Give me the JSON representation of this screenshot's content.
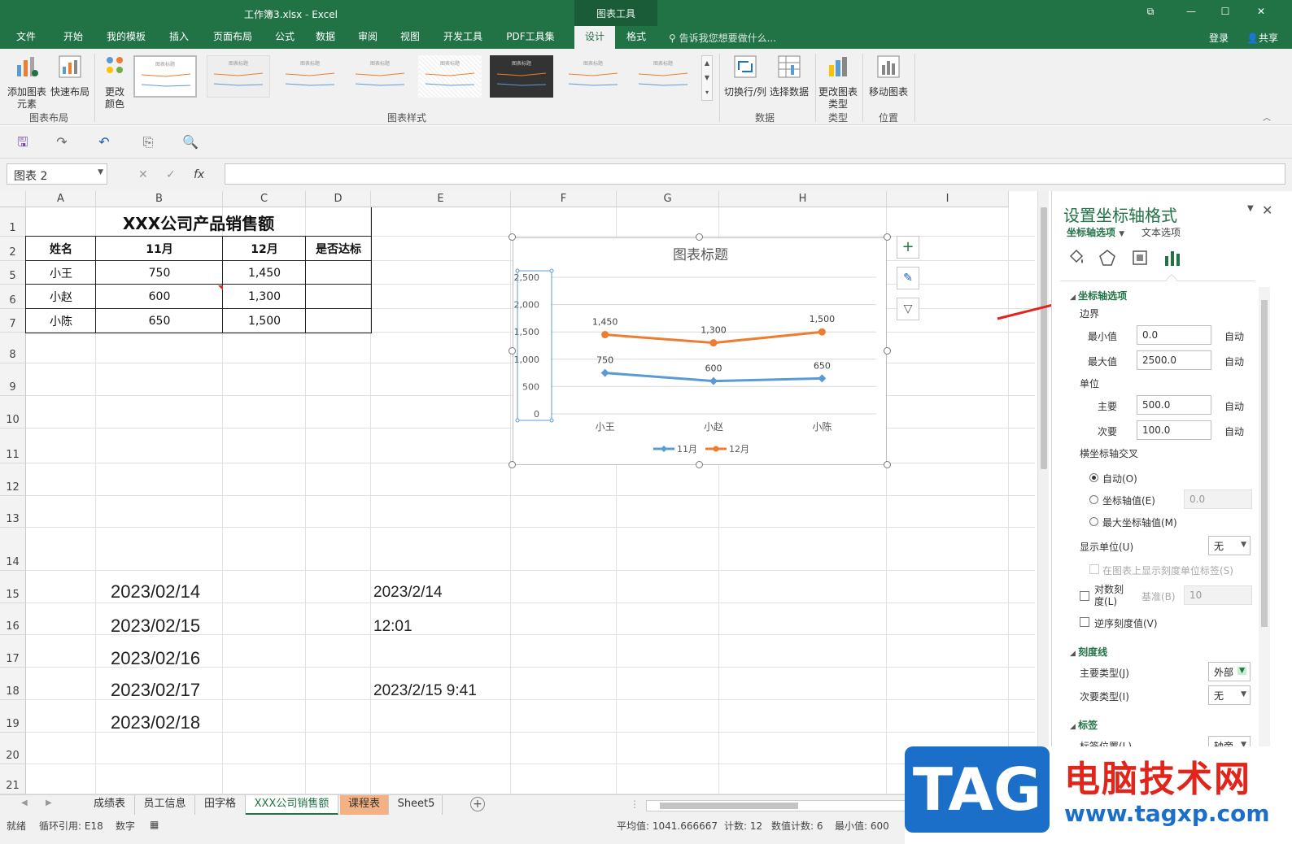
{
  "window": {
    "title": "工作簿3.xlsx - Excel",
    "chart_tools": "图表工具",
    "restore": "⧉",
    "minimize": "—",
    "maximize": "☐",
    "close": "✕"
  },
  "ribbon_tabs": [
    "文件",
    "开始",
    "我的模板",
    "插入",
    "页面布局",
    "公式",
    "数据",
    "审阅",
    "视图",
    "开发工具",
    "PDF工具集",
    "设计",
    "格式"
  ],
  "tell_me": "告诉我您想要做什么...",
  "login": "登录",
  "share": "共享",
  "ribbon": {
    "add_element": "添加图表元素",
    "quick_layout": "快速布局",
    "layout_group": "图表布局",
    "change_colors": "更改颜色",
    "styles_group": "图表样式",
    "style_thumb_title": "图表标题",
    "switch_rowcol": "切换行/列",
    "select_data": "选择数据",
    "data_group": "数据",
    "change_type": "更改图表类型",
    "type_group": "类型",
    "move_chart": "移动图表",
    "location_group": "位置"
  },
  "name_box": "图表 2",
  "fx": "fx",
  "columns": [
    "A",
    "B",
    "C",
    "D",
    "E",
    "F",
    "G",
    "H",
    "I"
  ],
  "rows": [
    "1",
    "2",
    "5",
    "6",
    "7",
    "8",
    "9",
    "10",
    "11",
    "12",
    "13",
    "14",
    "15",
    "16",
    "17",
    "18",
    "19",
    "20",
    "21"
  ],
  "table": {
    "title": "XXX公司产品销售额",
    "headers": [
      "姓名",
      "11月",
      "12月",
      "是否达标"
    ],
    "rows": [
      [
        "小王",
        "750",
        "1,450",
        ""
      ],
      [
        "小赵",
        "600",
        "1,300",
        ""
      ],
      [
        "小陈",
        "650",
        "1,500",
        ""
      ]
    ]
  },
  "dates_b": [
    "2023/02/14",
    "2023/02/15",
    "2023/02/16",
    "2023/02/17",
    "2023/02/18"
  ],
  "values_e": [
    "2023/2/14",
    "12:01",
    "2023/2/15 9:41"
  ],
  "chart_data": {
    "type": "line",
    "title": "图表标题",
    "categories": [
      "小王",
      "小赵",
      "小陈"
    ],
    "series": [
      {
        "name": "11月",
        "values": [
          750,
          600,
          650
        ],
        "color": "#5b9bd5",
        "labels": [
          "750",
          "600",
          "650"
        ]
      },
      {
        "name": "12月",
        "values": [
          1450,
          1300,
          1500
        ],
        "color": "#ed7d31",
        "labels": [
          "1,450",
          "1,300",
          "1,500"
        ]
      }
    ],
    "y_ticks": [
      "0",
      "500",
      "1,000",
      "1,500",
      "2,000",
      "2,500"
    ],
    "ylim": [
      0,
      2500
    ],
    "legend": "bottom",
    "grid": true
  },
  "chart_buttons": {
    "add": "+",
    "style": "✎",
    "filter": "▽"
  },
  "pane": {
    "title": "设置坐标轴格式",
    "axis_options": "坐标轴选项",
    "text_options": "文本选项",
    "section_axis": "坐标轴选项",
    "bounds": "边界",
    "min_label": "最小值",
    "min_value": "0.0",
    "max_label": "最大值",
    "max_value": "2500.0",
    "auto": "自动",
    "units": "单位",
    "major_label": "主要",
    "major_value": "500.0",
    "minor_label": "次要",
    "minor_value": "100.0",
    "cross": "横坐标轴交叉",
    "cross_auto": "自动(O)",
    "cross_value": "坐标轴值(E)",
    "cross_value_input": "0.0",
    "cross_max": "最大坐标轴值(M)",
    "display_units": "显示单位(U)",
    "display_units_value": "无",
    "show_units_label": "在图表上显示刻度单位标签(S)",
    "log_scale": "对数刻度(L)",
    "log_base": "基准(B)",
    "log_base_value": "10",
    "reverse": "逆序刻度值(V)",
    "section_ticks": "刻度线",
    "major_type": "主要类型(J)",
    "major_type_value": "外部",
    "minor_type": "次要类型(I)",
    "minor_type_value": "无",
    "section_labels": "标签",
    "label_pos": "标签位置(L)",
    "label_pos_value": "轴旁"
  },
  "sheet_tabs": [
    "成绩表",
    "员工信息",
    "田字格",
    "XXX公司销售额",
    "课程表",
    "Sheet5"
  ],
  "status": {
    "ready": "就绪",
    "circular": "循环引用: E18",
    "num": "数字",
    "avg": "平均值: 1041.666667",
    "count": "计数: 12",
    "numcount": "数值计数: 6",
    "min": "最小值: 600"
  },
  "watermark": {
    "tag": "TAG",
    "brand": "电脑技术网",
    "url": "www.tagxp.com"
  },
  "colors": {
    "excel_green": "#217346",
    "series1": "#5b9bd5",
    "series2": "#ed7d31",
    "arrow": "#e1251b"
  }
}
